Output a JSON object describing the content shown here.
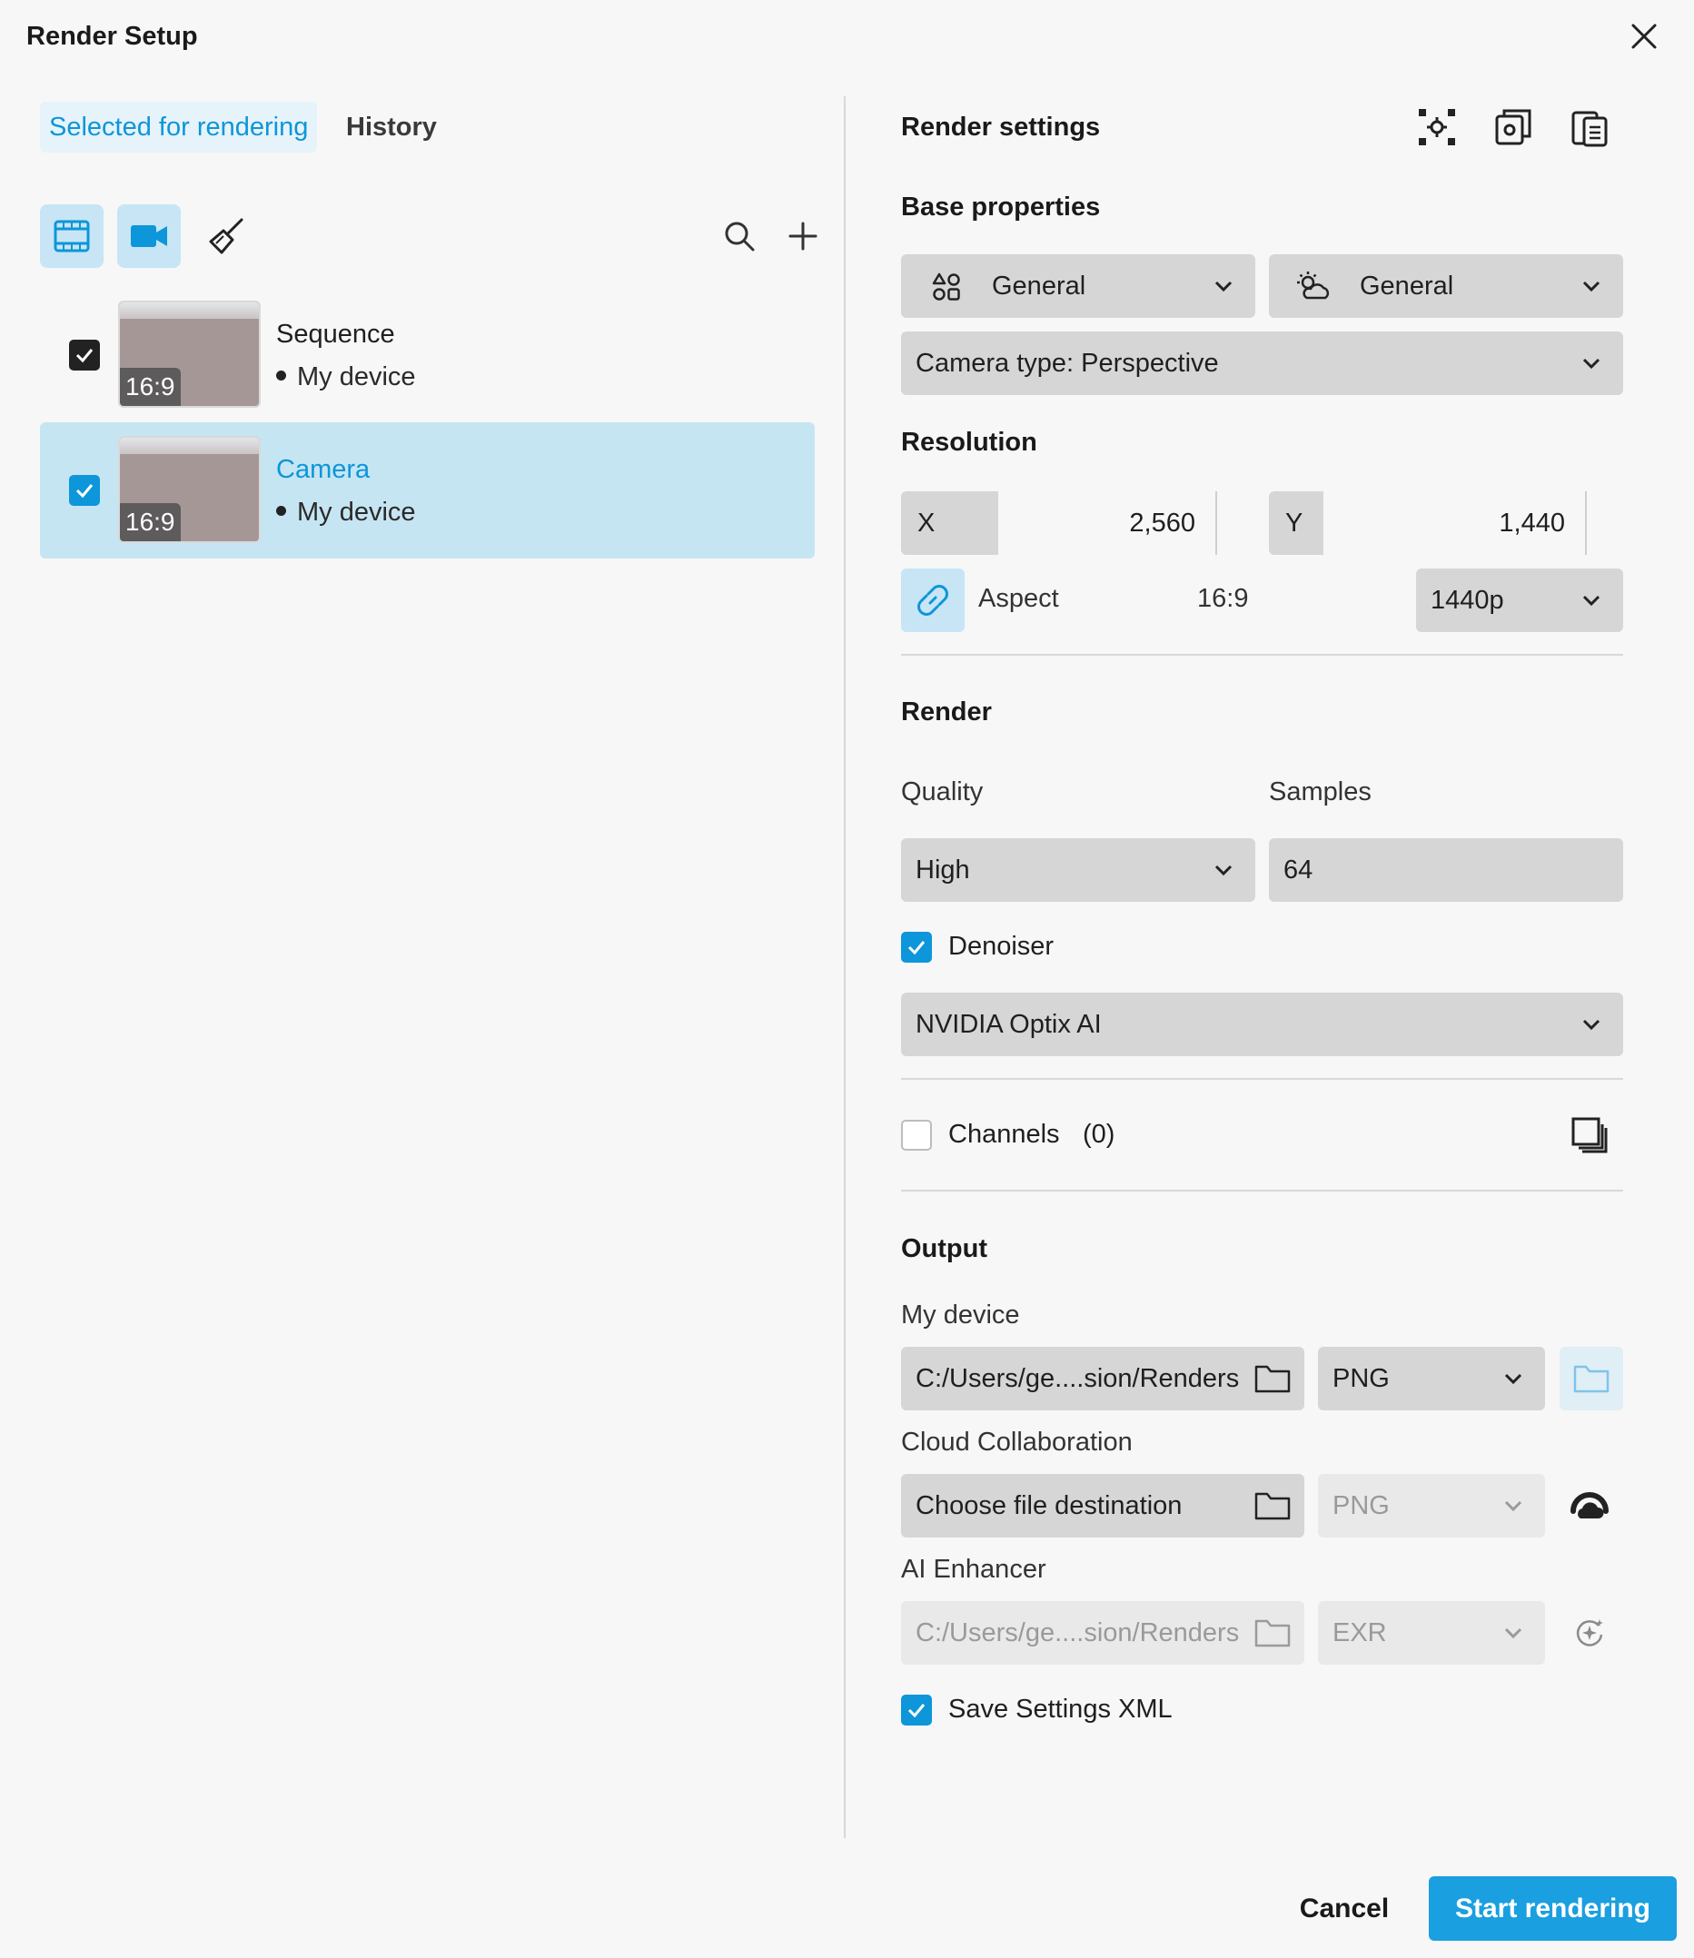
{
  "window": {
    "title": "Render Setup"
  },
  "left": {
    "tabs": [
      {
        "label": "Selected for rendering"
      },
      {
        "label": "History"
      }
    ],
    "items": [
      {
        "name": "Sequence",
        "device": "My device",
        "ratio": "16:9",
        "checked": true
      },
      {
        "name": "Camera",
        "device": "My device",
        "ratio": "16:9",
        "checked": true
      }
    ]
  },
  "right": {
    "header": "Render settings",
    "base": {
      "heading": "Base properties",
      "env1": "General",
      "env2": "General",
      "camera": "Camera type: Perspective"
    },
    "resolution": {
      "heading": "Resolution",
      "x_label": "X",
      "x_value": "2,560",
      "y_label": "Y",
      "y_value": "1,440",
      "aspect_label": "Aspect",
      "aspect_value": "16:9",
      "preset": "1440p"
    },
    "render": {
      "heading": "Render",
      "quality_label": "Quality",
      "quality_value": "High",
      "samples_label": "Samples",
      "samples_value": "64",
      "denoiser_label": "Denoiser",
      "denoiser_value": "NVIDIA Optix AI",
      "channels_label": "Channels",
      "channels_count": "(0)"
    },
    "output": {
      "heading": "Output",
      "device_label": "My device",
      "device_path": "C:/Users/ge....sion/Renders",
      "device_format": "PNG",
      "cloud_label": "Cloud Collaboration",
      "cloud_path": "Choose file destination",
      "cloud_format": "PNG",
      "ai_label": "AI Enhancer",
      "ai_path": "C:/Users/ge....sion/Renders",
      "ai_format": "EXR",
      "save_xml_label": "Save Settings XML"
    }
  },
  "footer": {
    "cancel": "Cancel",
    "start": "Start rendering"
  },
  "colors": {
    "accent": "#0d96d9",
    "selected_bg": "#c6e5f3",
    "field_bg": "#d6d6d6"
  }
}
